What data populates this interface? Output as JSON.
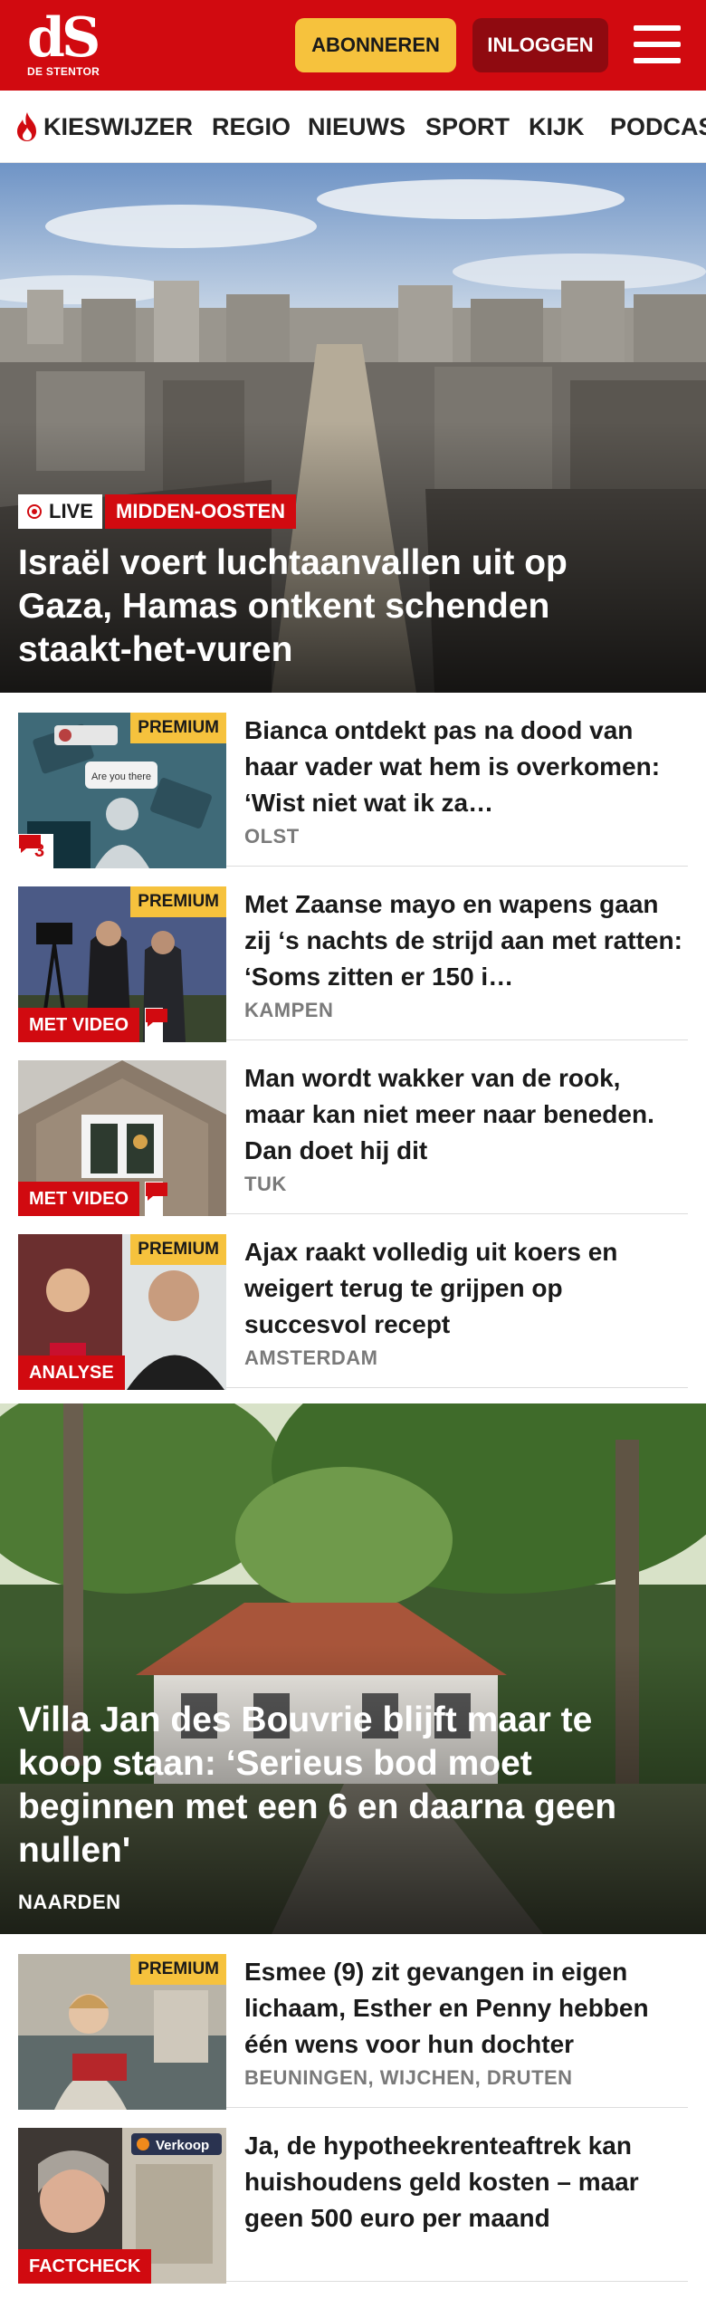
{
  "header": {
    "logo_mark": "dS",
    "logo_name": "DE STENTOR",
    "subscribe_label": "ABONNEREN",
    "login_label": "INLOGGEN",
    "menu_icon": "hamburger-menu-icon",
    "brand_color": "#d10a10",
    "accent_color": "#f6c23d"
  },
  "nav": {
    "items": [
      {
        "label": "KIESWIJZER",
        "icon": "flame-icon"
      },
      {
        "label": "REGIO"
      },
      {
        "label": "NIEUWS"
      },
      {
        "label": "SPORT"
      },
      {
        "label": "KIJK"
      },
      {
        "label": "PODCAS"
      }
    ]
  },
  "hero": {
    "live_label": "LIVE",
    "category": "MIDDEN-OOSTEN",
    "title": "Israël voert luchtaanvallen uit op Gaza, Hamas ontkent schenden staakt-het-vuren"
  },
  "articles": [
    {
      "title": "Bianca ontdekt pas na dood van haar vader wat hem is overkomen: ‘Wist niet wat ik za…",
      "location": "OLST",
      "premium": "PREMIUM",
      "comment_count": "3"
    },
    {
      "title": "Met Zaanse mayo en wapens gaan zij ‘s nachts de strijd aan met ratten: ‘Soms zitten er 150 i…",
      "location": "KAMPEN",
      "premium": "PREMIUM",
      "badge": "MET VIDEO"
    },
    {
      "title": "Man wordt wakker van de rook, maar kan niet meer naar beneden. Dan doet hij dit",
      "location": "TUK",
      "badge": "MET VIDEO"
    },
    {
      "title": "Ajax raakt volledig uit koers en weigert terug te grijpen op succesvol recept",
      "location": "AMSTERDAM",
      "premium": "PREMIUM",
      "badge": "ANALYSE"
    }
  ],
  "feature": {
    "title": "Villa Jan des Bouvrie blijft maar te koop staan: ‘Serieus bod moet beginnen met een 6 en daarna geen nullen'",
    "location": "NAARDEN"
  },
  "articles2": [
    {
      "title": "Esmee (9) zit gevangen in eigen lichaam, Esther en Penny hebben één wens voor hun dochter",
      "location": "BEUNINGEN, WIJCHEN, DRUTEN",
      "premium": "PREMIUM"
    },
    {
      "title": "Ja, de hypotheekrenteaftrek kan huishoudens geld kosten – maar geen 500 euro per maand",
      "badge": "FACTCHECK",
      "sign_text": "Verkoop"
    }
  ]
}
